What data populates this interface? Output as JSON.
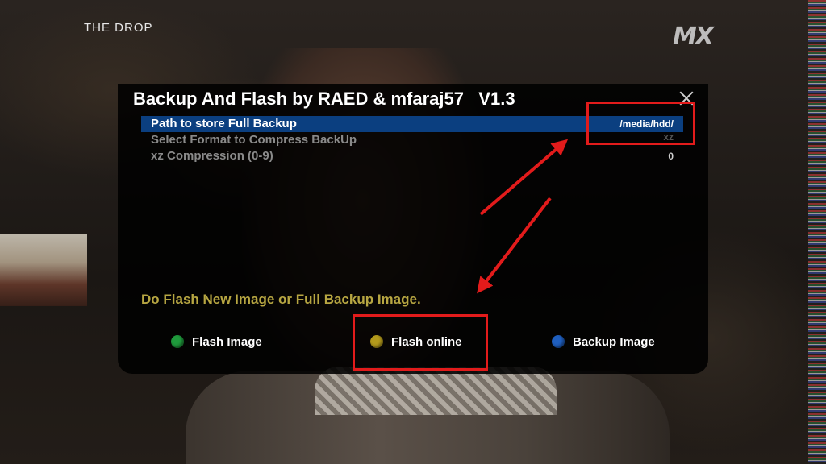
{
  "overlay": {
    "channel_title": "THE DROP",
    "channel_logo": "MX"
  },
  "dialog": {
    "title": "Backup And Flash by RAED & mfaraj57   V1.3",
    "close_icon": "close-icon",
    "settings": [
      {
        "label": "Path to store Full Backup",
        "value": "/media/hdd/",
        "selected": true
      },
      {
        "label": "Select Format to Compress BackUp",
        "value": "xz",
        "selected": false
      },
      {
        "label": "xz Compression (0-9)",
        "value": "0",
        "selected": false
      }
    ],
    "hint": "Do Flash New Image or Full Backup Image.",
    "buttons": [
      {
        "label": "Flash Image",
        "color": "#1f9a3c"
      },
      {
        "label": "Flash online",
        "color": "#b39a1c"
      },
      {
        "label": "Backup Image",
        "color": "#1f5fbf"
      }
    ]
  },
  "annotations": {
    "color": "#e21b1b"
  }
}
